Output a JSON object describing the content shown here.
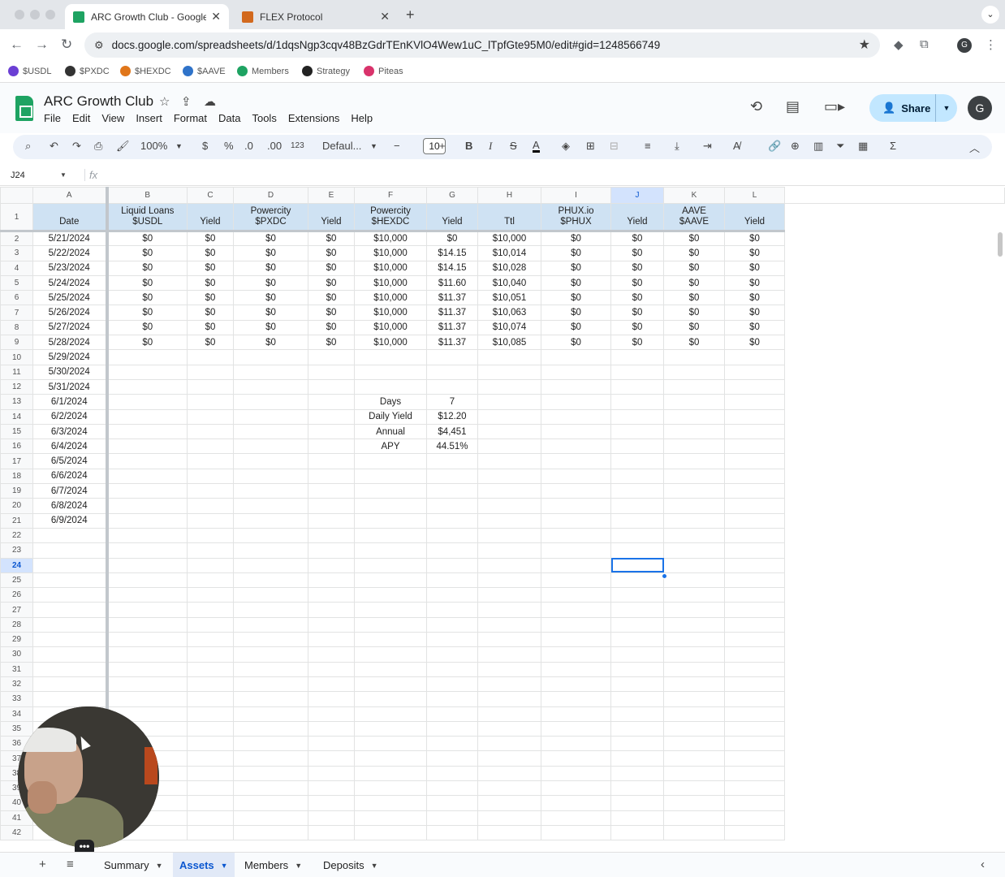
{
  "browser": {
    "tabs": [
      {
        "title": "ARC Growth Club - Google Sl",
        "favicon_color": "#1ea362",
        "active": true
      },
      {
        "title": "FLEX Protocol",
        "favicon_color": "#d2691e",
        "active": false
      }
    ],
    "new_tab": "+",
    "url": "docs.google.com/spreadsheets/d/1dqsNgp3cqv48BzGdrTEnKVlO4Wew1uC_lTpfGte95M0/edit#gid=1248566749",
    "profile_letter": "G",
    "bookmarks": [
      {
        "label": "$USDL",
        "color": "#6b3fd4"
      },
      {
        "label": "$PXDC",
        "color": "#333333"
      },
      {
        "label": "$HEXDC",
        "color": "#e0761a"
      },
      {
        "label": "$AAVE",
        "color": "#2f73c9"
      },
      {
        "label": "Members",
        "color": "#1ea362"
      },
      {
        "label": "Strategy",
        "color": "#222222"
      },
      {
        "label": "Piteas",
        "color": "#d9336b"
      }
    ]
  },
  "sheets": {
    "title": "ARC Growth Club",
    "menus": [
      "File",
      "Edit",
      "View",
      "Insert",
      "Format",
      "Data",
      "Tools",
      "Extensions",
      "Help"
    ],
    "share_label": "Share",
    "account_letter": "G",
    "toolbar": {
      "zoom": "100%",
      "currency": "$",
      "percent": "%",
      "dec_dec": ".0",
      "inc_dec": ".00",
      "number_format": "123",
      "font": "Defaul...",
      "font_size": "10"
    },
    "name_box": "J24",
    "fx_label": "fx"
  },
  "grid": {
    "columns": [
      "A",
      "B",
      "C",
      "D",
      "E",
      "F",
      "G",
      "H",
      "I",
      "J",
      "K",
      "L"
    ],
    "selected_column": "J",
    "selected_row": 24,
    "header_row": {
      "A": "Date",
      "B": "Liquid Loans\n$USDL",
      "C": "Yield",
      "D": "Powercity\n$PXDC",
      "E": "Yield",
      "F": "Powercity\n$HEXDC",
      "G": "Yield",
      "H": "Ttl",
      "I": "PHUX.io\n$PHUX",
      "J": "Yield",
      "K": "AAVE\n$AAVE",
      "L": "Yield"
    },
    "data_rows": [
      {
        "row": 2,
        "cells": [
          "5/21/2024",
          "$0",
          "$0",
          "$0",
          "$0",
          "$10,000",
          "$0",
          "$10,000",
          "$0",
          "$0",
          "$0",
          "$0"
        ]
      },
      {
        "row": 3,
        "cells": [
          "5/22/2024",
          "$0",
          "$0",
          "$0",
          "$0",
          "$10,000",
          "$14.15",
          "$10,014",
          "$0",
          "$0",
          "$0",
          "$0"
        ]
      },
      {
        "row": 4,
        "cells": [
          "5/23/2024",
          "$0",
          "$0",
          "$0",
          "$0",
          "$10,000",
          "$14.15",
          "$10,028",
          "$0",
          "$0",
          "$0",
          "$0"
        ]
      },
      {
        "row": 5,
        "cells": [
          "5/24/2024",
          "$0",
          "$0",
          "$0",
          "$0",
          "$10,000",
          "$11.60",
          "$10,040",
          "$0",
          "$0",
          "$0",
          "$0"
        ]
      },
      {
        "row": 6,
        "cells": [
          "5/25/2024",
          "$0",
          "$0",
          "$0",
          "$0",
          "$10,000",
          "$11.37",
          "$10,051",
          "$0",
          "$0",
          "$0",
          "$0"
        ]
      },
      {
        "row": 7,
        "cells": [
          "5/26/2024",
          "$0",
          "$0",
          "$0",
          "$0",
          "$10,000",
          "$11.37",
          "$10,063",
          "$0",
          "$0",
          "$0",
          "$0"
        ]
      },
      {
        "row": 8,
        "cells": [
          "5/27/2024",
          "$0",
          "$0",
          "$0",
          "$0",
          "$10,000",
          "$11.37",
          "$10,074",
          "$0",
          "$0",
          "$0",
          "$0"
        ]
      },
      {
        "row": 9,
        "cells": [
          "5/28/2024",
          "$0",
          "$0",
          "$0",
          "$0",
          "$10,000",
          "$11.37",
          "$10,085",
          "$0",
          "$0",
          "$0",
          "$0"
        ]
      }
    ],
    "date_only_rows": [
      {
        "row": 10,
        "date": "5/29/2024"
      },
      {
        "row": 11,
        "date": "5/30/2024"
      },
      {
        "row": 12,
        "date": "5/31/2024"
      },
      {
        "row": 13,
        "date": "6/1/2024"
      },
      {
        "row": 14,
        "date": "6/2/2024"
      },
      {
        "row": 15,
        "date": "6/3/2024"
      },
      {
        "row": 16,
        "date": "6/4/2024"
      },
      {
        "row": 17,
        "date": "6/5/2024"
      },
      {
        "row": 18,
        "date": "6/6/2024"
      },
      {
        "row": 19,
        "date": "6/7/2024"
      },
      {
        "row": 20,
        "date": "6/8/2024"
      },
      {
        "row": 21,
        "date": "6/9/2024"
      }
    ],
    "summary": [
      {
        "row": 13,
        "label": "Days",
        "value": "7"
      },
      {
        "row": 14,
        "label": "Daily Yield",
        "value": "$12.20"
      },
      {
        "row": 15,
        "label": "Annual",
        "value": "$4,451"
      },
      {
        "row": 16,
        "label": "APY",
        "value": "44.51%"
      }
    ],
    "last_row": 42
  },
  "sheet_tabs": [
    {
      "label": "Summary",
      "active": false
    },
    {
      "label": "Assets",
      "active": true
    },
    {
      "label": "Members",
      "active": false
    },
    {
      "label": "Deposits",
      "active": false
    }
  ],
  "webcam_menu": "•••"
}
